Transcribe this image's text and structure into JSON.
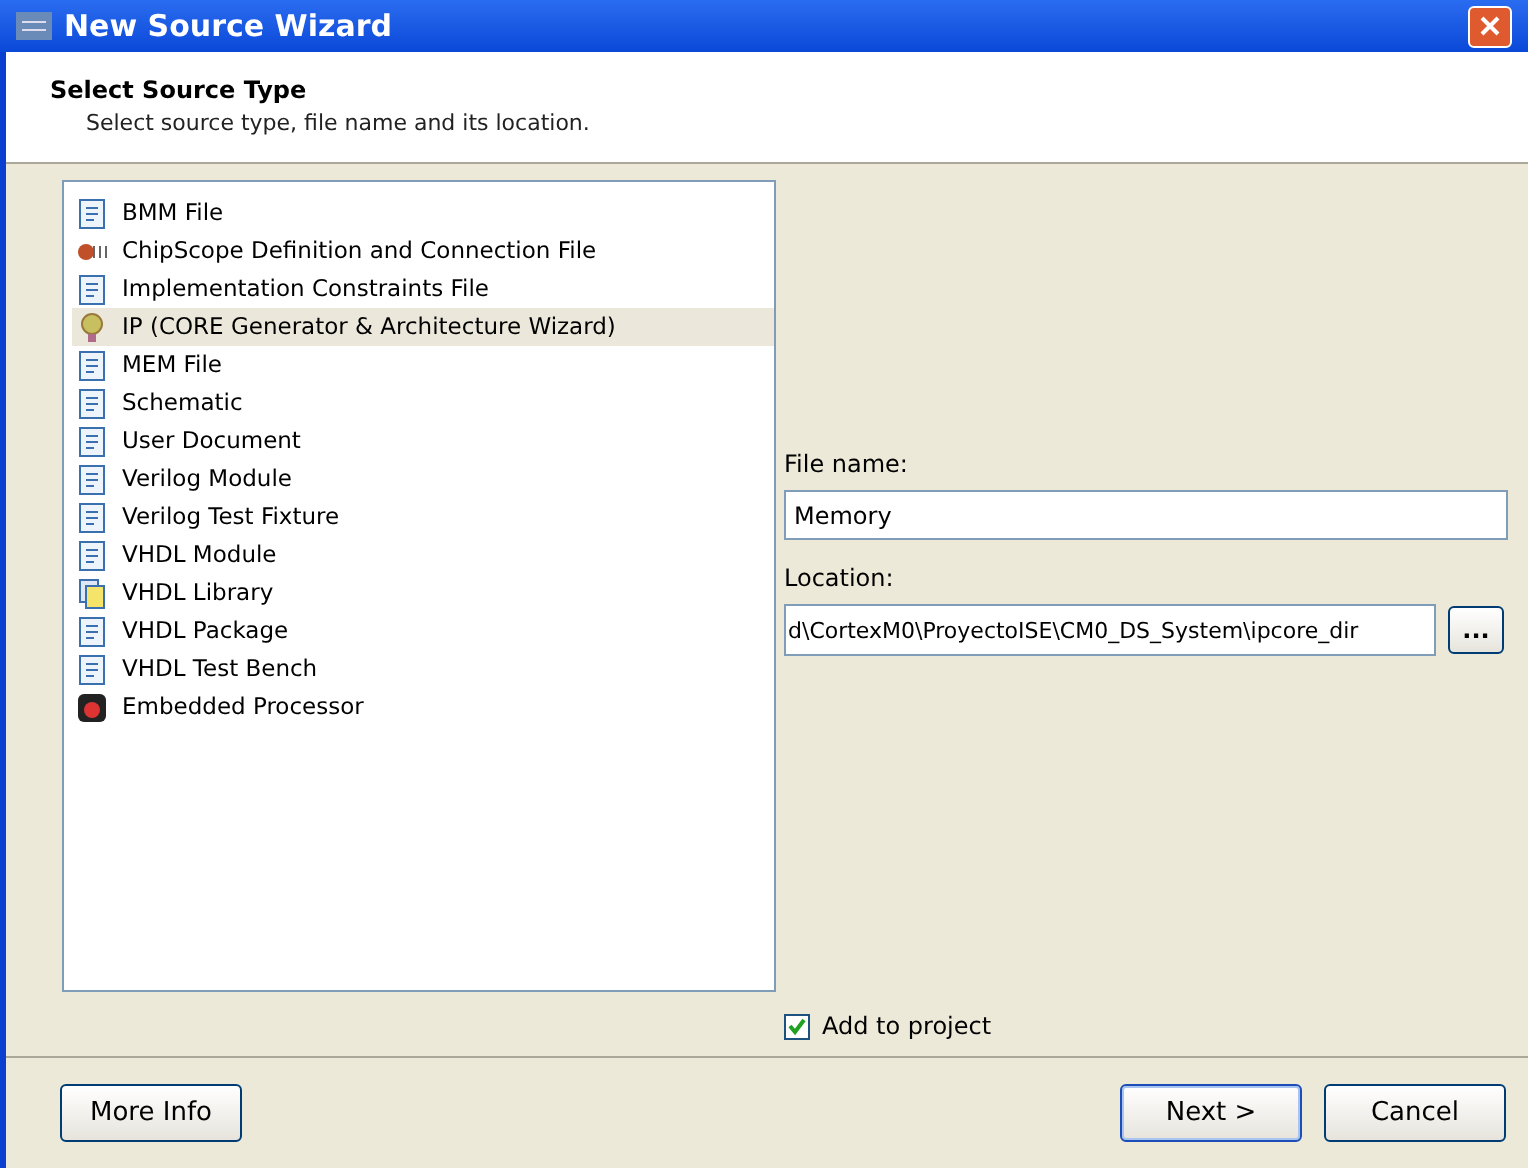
{
  "window": {
    "title": "New Source Wizard"
  },
  "header": {
    "title": "Select Source Type",
    "subtitle": "Select source type, file name and its location."
  },
  "source_types": [
    {
      "label": "BMM File",
      "kind": "file",
      "selected": false
    },
    {
      "label": "ChipScope Definition and Connection File",
      "kind": "probe",
      "selected": false
    },
    {
      "label": "Implementation Constraints File",
      "kind": "file",
      "selected": false
    },
    {
      "label": "IP (CORE Generator & Architecture Wizard)",
      "kind": "core",
      "selected": true
    },
    {
      "label": "MEM File",
      "kind": "file",
      "selected": false
    },
    {
      "label": "Schematic",
      "kind": "file",
      "selected": false
    },
    {
      "label": "User Document",
      "kind": "file",
      "selected": false
    },
    {
      "label": "Verilog Module",
      "kind": "file",
      "selected": false
    },
    {
      "label": "Verilog Test Fixture",
      "kind": "file",
      "selected": false
    },
    {
      "label": "VHDL Module",
      "kind": "file",
      "selected": false
    },
    {
      "label": "VHDL Library",
      "kind": "library",
      "selected": false
    },
    {
      "label": "VHDL Package",
      "kind": "file",
      "selected": false
    },
    {
      "label": "VHDL Test Bench",
      "kind": "file",
      "selected": false
    },
    {
      "label": "Embedded Processor",
      "kind": "processor",
      "selected": false
    }
  ],
  "file_name": {
    "label": "File name:",
    "value": "Memory"
  },
  "location": {
    "label": "Location:",
    "value": "d\\CortexM0\\ProyectoISE\\CM0_DS_System\\ipcore_dir",
    "browse": "..."
  },
  "add_to_project": {
    "label": "Add to project",
    "checked": true
  },
  "buttons": [
    {
      "label": "More Info",
      "kind": "left"
    },
    {
      "label": "Next >",
      "kind": "default"
    },
    {
      "label": "Cancel",
      "kind": "normal"
    }
  ]
}
